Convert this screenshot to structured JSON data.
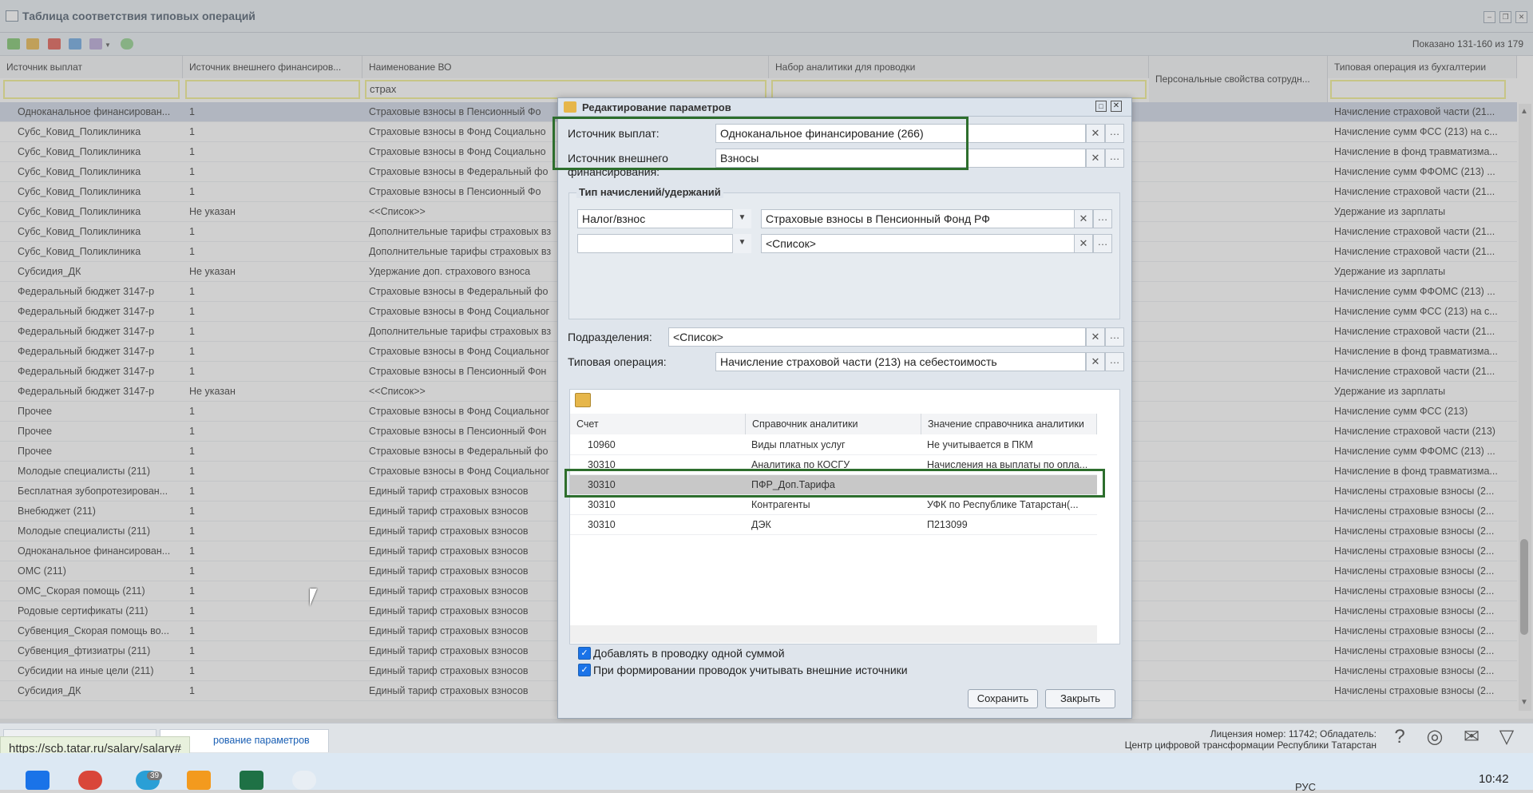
{
  "window": {
    "title": "Таблица соответствия типовых операций",
    "shown": "Показано 131-160 из 179"
  },
  "grid": {
    "columns": [
      "Источник выплат",
      "Источник внешнего финансиров...",
      "Наименование ВО",
      "Набор аналитики для проводки",
      "Персональные свойства сотрудн...",
      "Типовая операция из бухгалтерии"
    ],
    "filter_name": "страх",
    "rows": [
      [
        "Одноканальное финансирован...",
        "1",
        "Страховые взносы в Пенсионный Фо",
        "Начисление страховой части (21..."
      ],
      [
        "Субс_Ковид_Поликлиника",
        "1",
        "Страховые взносы в Фонд Социально",
        "Начисление сумм ФСС (213) на с..."
      ],
      [
        "Субс_Ковид_Поликлиника",
        "1",
        "Страховые взносы в Фонд Социально",
        "Начисление в фонд травматизма..."
      ],
      [
        "Субс_Ковид_Поликлиника",
        "1",
        "Страховые взносы в Федеральный фо",
        "Начисление сумм ФФОМС (213) ..."
      ],
      [
        "Субс_Ковид_Поликлиника",
        "1",
        "Страховые взносы в Пенсионный Фо",
        "Начисление страховой части (21..."
      ],
      [
        "Субс_Ковид_Поликлиника",
        "Не указан",
        "<<Список>>",
        "Удержание из зарплаты"
      ],
      [
        "Субс_Ковид_Поликлиника",
        "1",
        "Дополнительные тарифы страховых вз",
        "Начисление страховой части (21..."
      ],
      [
        "Субс_Ковид_Поликлиника",
        "1",
        "Дополнительные тарифы страховых вз",
        "Начисление страховой части (21..."
      ],
      [
        "Субсидия_ДК",
        "Не указан",
        "Удержание доп. страхового взноса",
        "Удержание из зарплаты"
      ],
      [
        "Федеральный бюджет 3147-р",
        "1",
        "Страховые взносы в Федеральный фо",
        "Начисление сумм ФФОМС (213) ..."
      ],
      [
        "Федеральный бюджет 3147-р",
        "1",
        "Страховые взносы в Фонд Социальног",
        "Начисление сумм ФСС (213) на с..."
      ],
      [
        "Федеральный бюджет 3147-р",
        "1",
        "Дополнительные тарифы страховых вз",
        "Начисление страховой части (21..."
      ],
      [
        "Федеральный бюджет 3147-р",
        "1",
        "Страховые взносы в Фонд Социальног",
        "Начисление в фонд травматизма..."
      ],
      [
        "Федеральный бюджет 3147-р",
        "1",
        "Страховые взносы в Пенсионный Фон",
        "Начисление страховой части (21..."
      ],
      [
        "Федеральный бюджет 3147-р",
        "Не указан",
        "<<Список>>",
        "Удержание из зарплаты"
      ],
      [
        "Прочее",
        "1",
        "Страховые взносы в Фонд Социальног",
        "Начисление сумм ФСС (213)"
      ],
      [
        "Прочее",
        "1",
        "Страховые взносы в Пенсионный Фон",
        "Начисление страховой части (213)"
      ],
      [
        "Прочее",
        "1",
        "Страховые взносы в Федеральный фо",
        "Начисление сумм ФФОМС (213) ..."
      ],
      [
        "Молодые специалисты (211)",
        "1",
        "Страховые взносы в Фонд Социальног",
        "Начисление в фонд травматизма..."
      ],
      [
        "Бесплатная зубопротезирован...",
        "1",
        "Единый тариф страховых взносов",
        "Начислены страховые взносы (2..."
      ],
      [
        "Внебюджет (211)",
        "1",
        "Единый тариф страховых взносов",
        "Начислены страховые взносы (2..."
      ],
      [
        "Молодые специалисты (211)",
        "1",
        "Единый тариф страховых взносов",
        "Начислены страховые взносы (2..."
      ],
      [
        "Одноканальное финансирован...",
        "1",
        "Единый тариф страховых взносов",
        "Начислены страховые взносы (2..."
      ],
      [
        "ОМС (211)",
        "1",
        "Единый тариф страховых взносов",
        "Начислены страховые взносы (2..."
      ],
      [
        "ОМС_Скорая помощь (211)",
        "1",
        "Единый тариф страховых взносов",
        "Начислены страховые взносы (2..."
      ],
      [
        "Родовые сертификаты (211)",
        "1",
        "Единый тариф страховых взносов",
        "Начислены страховые взносы (2..."
      ],
      [
        "Субвенция_Скорая помощь во...",
        "1",
        "Единый тариф страховых взносов",
        "Начислены страховые взносы (2..."
      ],
      [
        "Субвенция_фтизиатры (211)",
        "1",
        "Единый тариф страховых взносов",
        "Начислены страховые взносы (2..."
      ],
      [
        "Субсидии на иные цели (211)",
        "1",
        "Единый тариф страховых взносов",
        "Начислены страховые взносы (2..."
      ],
      [
        "Субсидия_ДК",
        "1",
        "Единый тариф страховых взносов",
        "Начислены страховые взносы (2..."
      ]
    ]
  },
  "dialog": {
    "title": "Редактирование параметров",
    "source_label": "Источник выплат:",
    "source_value": "Одноканальное финансирование (266)",
    "ext_label_1": "Источник внешнего",
    "ext_label_2": "финансирования:",
    "ext_value": "Взносы",
    "type_legend": "Тип начислений/удержаний",
    "type1_kind": "Налог/взнос",
    "type1_value": "Страховые взносы в Пенсионный Фонд РФ",
    "type2_kind": "",
    "type2_value": "<Список>",
    "dept_label": "Подразделения:",
    "dept_value": "<Список>",
    "op_label": "Типовая операция:",
    "op_value": "Начисление страховой части (213) на себестоимость",
    "table_headers": [
      "Счет",
      "Справочник аналитики",
      "Значение справочника аналитики"
    ],
    "table_rows": [
      [
        "10960",
        "Виды платных услуг",
        "Не учитывается в ПКМ"
      ],
      [
        "30310",
        "Аналитика по КОСГУ",
        "Начисления на выплаты по опла..."
      ],
      [
        "30310",
        "ПФР_Доп.Тарифа",
        ""
      ],
      [
        "30310",
        "Контрагенты",
        "УФК по Республике Татарстан(..."
      ],
      [
        "30310",
        "ДЭК",
        "П213099"
      ]
    ],
    "chk1_label": "Добавлять в проводку одной суммой",
    "chk2_label": "При формировании проводок учитывать внешние источники",
    "save": "Сохранить",
    "close": "Закрыть"
  },
  "statusbar": {
    "tab_label": "рование параметров",
    "url_tip": "https://scb.tatar.ru/salary/salary#",
    "license_line1": "Лицензия номер: 11742; Обладатель:",
    "license_line2": "Центр цифровой трансформации Республики Татарстан"
  },
  "taskbar": {
    "chrome_badge": "39",
    "lang": "РУС",
    "time": "10:42"
  }
}
